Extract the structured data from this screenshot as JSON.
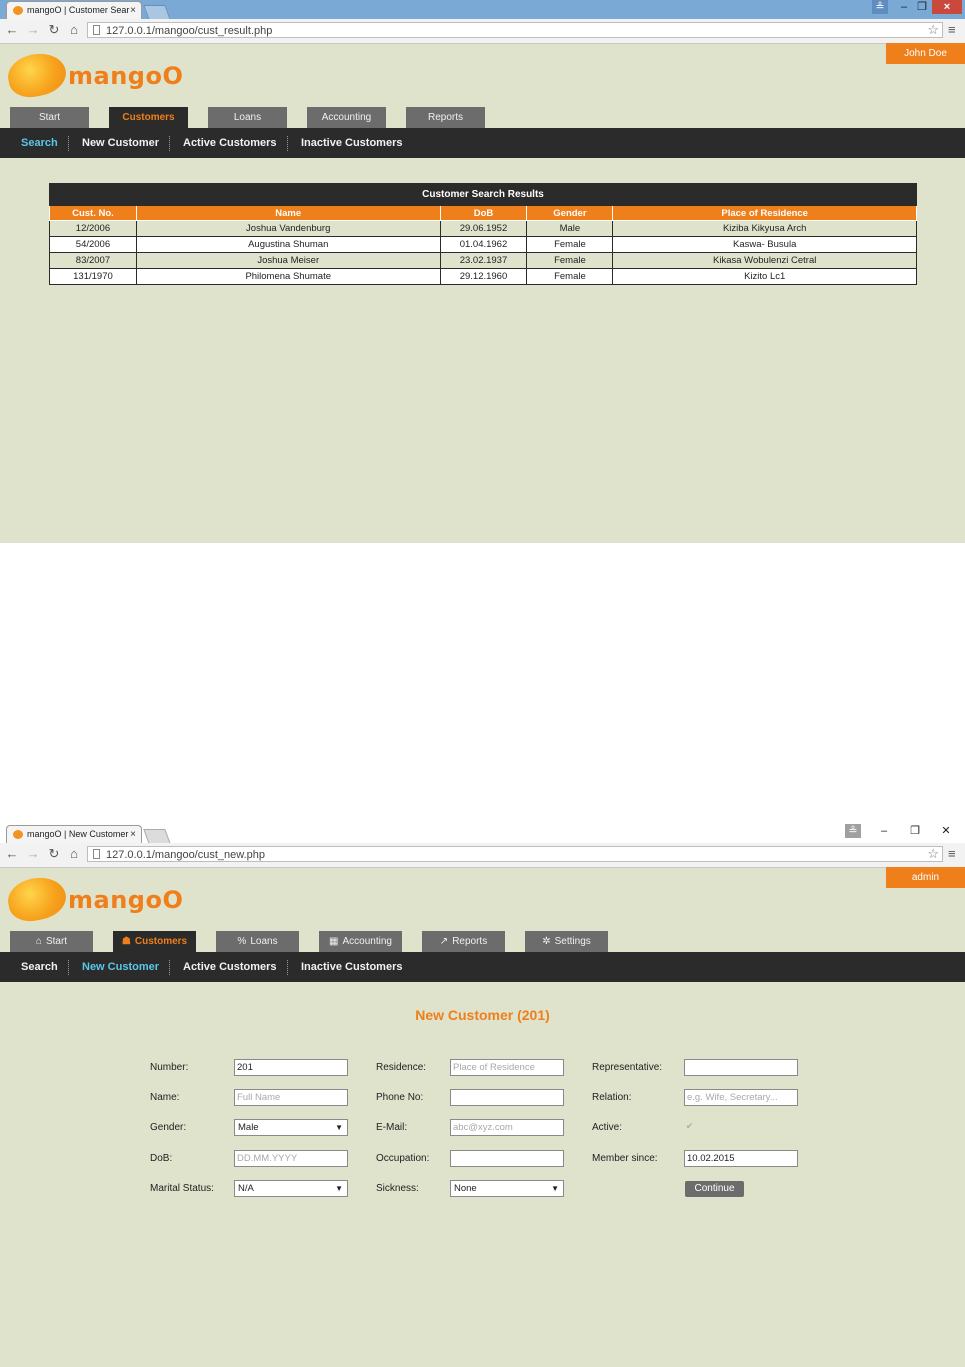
{
  "screen1": {
    "browser": {
      "tab_title": "mangoO | Customer Sear",
      "tab_close": "×",
      "url": "127.0.0.1/mangoo/cust_result.php",
      "win_user": "≗",
      "win_min": "–",
      "win_max": "❐",
      "win_close": "×"
    },
    "app": {
      "logo_text": "mangoO",
      "user": "John Doe",
      "tabs": [
        {
          "label": "Start",
          "icon": ""
        },
        {
          "label": "Customers",
          "icon": ""
        },
        {
          "label": "Loans",
          "icon": ""
        },
        {
          "label": "Accounting",
          "icon": ""
        },
        {
          "label": "Reports",
          "icon": ""
        }
      ],
      "active_tab": "Customers",
      "subnav": [
        "Search",
        "New Customer",
        "Active Customers",
        "Inactive Customers"
      ],
      "active_subnav": "Search"
    },
    "results": {
      "caption": "Customer Search Results",
      "columns": [
        "Cust. No.",
        "Name",
        "DoB",
        "Gender",
        "Place of Residence"
      ],
      "rows": [
        [
          "12/2006",
          "Joshua Vandenburg",
          "29.06.1952",
          "Male",
          "Kiziba Kikyusa Arch"
        ],
        [
          "54/2006",
          "Augustina Shuman",
          "01.04.1962",
          "Female",
          "Kaswa- Busula"
        ],
        [
          "83/2007",
          "Joshua Meiser",
          "23.02.1937",
          "Female",
          "Kikasa Wobulenzi Cetral"
        ],
        [
          "131/1970",
          "Philomena Shumate",
          "29.12.1960",
          "Female",
          "Kizito Lc1"
        ]
      ]
    }
  },
  "screen2": {
    "browser": {
      "tab_title": "mangoO | New Customer",
      "tab_close": "×",
      "url": "127.0.0.1/mangoo/cust_new.php",
      "win_user": "≗",
      "win_min": "–",
      "win_max": "❐",
      "win_close": "✕"
    },
    "app": {
      "logo_text": "mangoO",
      "user": "admin",
      "tabs": [
        {
          "label": "Start",
          "icon": "⌂"
        },
        {
          "label": "Customers",
          "icon": "☗"
        },
        {
          "label": "Loans",
          "icon": "%"
        },
        {
          "label": "Accounting",
          "icon": "▦"
        },
        {
          "label": "Reports",
          "icon": "↗"
        },
        {
          "label": "Settings",
          "icon": "✲"
        }
      ],
      "active_tab": "Customers",
      "subnav": [
        "Search",
        "New Customer",
        "Active Customers",
        "Inactive Customers"
      ],
      "active_subnav": "New Customer"
    },
    "form": {
      "title": "New Customer (201)",
      "labels": {
        "number": "Number:",
        "name": "Name:",
        "gender": "Gender:",
        "dob": "DoB:",
        "marital": "Marital Status:",
        "residence": "Residence:",
        "phone": "Phone No:",
        "email": "E-Mail:",
        "occupation": "Occupation:",
        "sickness": "Sickness:",
        "representative": "Representative:",
        "relation": "Relation:",
        "active": "Active:",
        "member_since": "Member since:"
      },
      "values": {
        "number": "201",
        "name": "",
        "gender": "Male",
        "dob": "",
        "marital": "N/A",
        "residence": "",
        "phone": "",
        "email": "",
        "occupation": "",
        "sickness": "None",
        "representative": "",
        "relation": "",
        "active": true,
        "member_since": "10.02.2015"
      },
      "placeholders": {
        "name": "Full Name",
        "dob": "DD.MM.YYYY",
        "residence": "Place of Residence",
        "email": "abc@xyz.com",
        "relation": "e.g. Wife, Secretary..."
      },
      "continue_label": "Continue"
    }
  }
}
